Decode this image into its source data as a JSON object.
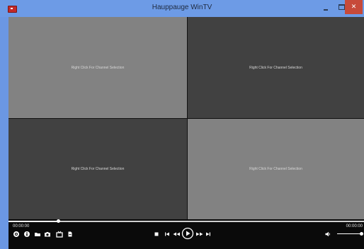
{
  "window": {
    "title": "Hauppauge WinTV",
    "close_glyph": "✕"
  },
  "panes": [
    {
      "label": "Right Click For Channel Selection"
    },
    {
      "label": "Right Click For Channel Selection"
    },
    {
      "label": "Right Click For Channel Selection"
    },
    {
      "label": "Right Click For Channel Selection"
    }
  ],
  "player": {
    "elapsed": "00:00:00",
    "total": "00:00:00",
    "seek_position": 0.14,
    "volume_level": 0.95
  },
  "icons": {
    "left_toolbar": [
      "settings-icon",
      "info-icon",
      "folder-icon",
      "camera-icon",
      "tv-icon",
      "document-icon"
    ],
    "transport": [
      "stop-icon",
      "skip-back-icon",
      "rewind-icon",
      "play-icon",
      "fast-forward-icon",
      "skip-forward-icon"
    ],
    "right": [
      "volume-icon"
    ]
  },
  "colors": {
    "titlebar": "#6d9be6",
    "close": "#c74a3a",
    "pane_light": "#828282",
    "pane_dark": "#414141",
    "controls_bg": "#0a0a0a"
  }
}
